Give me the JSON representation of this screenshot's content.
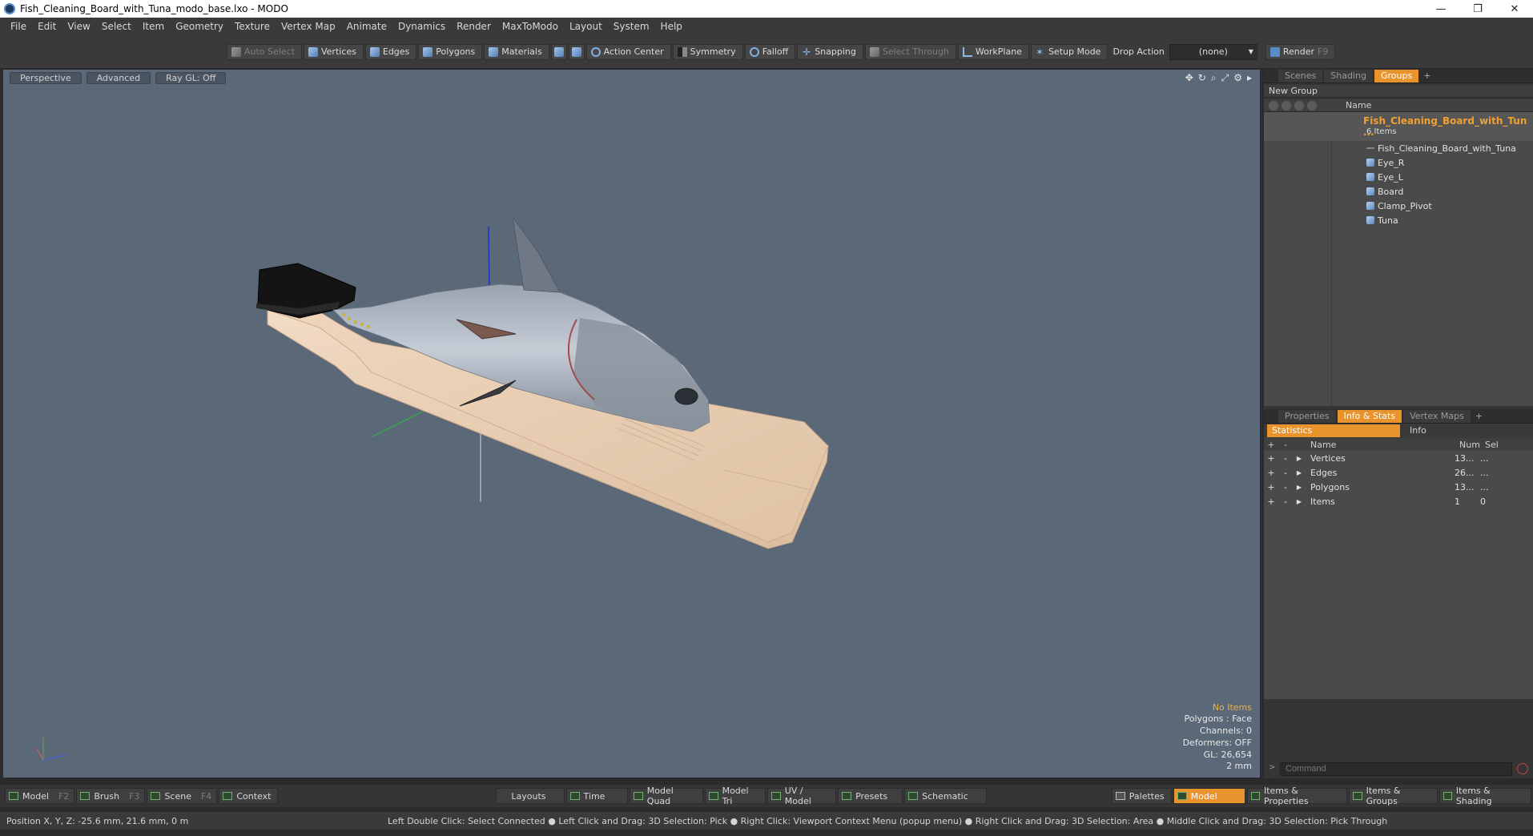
{
  "window": {
    "title": "Fish_Cleaning_Board_with_Tuna_modo_base.lxo - MODO",
    "minimize": "—",
    "restore": "❐",
    "close": "✕"
  },
  "menu": [
    "File",
    "Edit",
    "View",
    "Select",
    "Item",
    "Geometry",
    "Texture",
    "Vertex Map",
    "Animate",
    "Dynamics",
    "Render",
    "MaxToModo",
    "Layout",
    "System",
    "Help"
  ],
  "toolbar": {
    "auto_select": "Auto Select",
    "vertices": "Vertices",
    "edges": "Edges",
    "polygons": "Polygons",
    "materials": "Materials",
    "action_center": "Action Center",
    "symmetry": "Symmetry",
    "falloff": "Falloff",
    "snapping": "Snapping",
    "select_through": "Select Through",
    "workplane": "WorkPlane",
    "setup_mode": "Setup Mode",
    "drop_action_label": "Drop Action",
    "drop_action_value": "(none)",
    "render": "Render",
    "render_key": "F9"
  },
  "viewport": {
    "tabs": [
      "Perspective",
      "Advanced",
      "Ray GL: Off"
    ],
    "info": {
      "selection": "No Items",
      "polygons": "Polygons : Face",
      "channels": "Channels: 0",
      "deformers": "Deformers: OFF",
      "gl": "GL: 26,654",
      "scale": "2 mm"
    },
    "colors": {
      "background": "#5b6878",
      "board": "#e6cbb0",
      "tuna": "#b4bcc8"
    }
  },
  "groups_panel": {
    "tabs": [
      "Scenes",
      "Shading",
      "Groups"
    ],
    "active_tab": "Groups",
    "new_group": "New Group",
    "column_name": "Name",
    "root": {
      "name": "Fish_Cleaning_Board_with_Tun ...",
      "count": "6 Items"
    },
    "items": [
      "Fish_Cleaning_Board_with_Tuna",
      "Eye_R",
      "Eye_L",
      "Board",
      "Clamp_Pivot",
      "Tuna"
    ]
  },
  "stats_panel": {
    "tabs": [
      "Properties",
      "Info & Stats",
      "Vertex Maps"
    ],
    "active_tab": "Info & Stats",
    "sub_tabs": {
      "statistics": "Statistics",
      "info": "Info"
    },
    "columns": {
      "name": "Name",
      "num": "Num",
      "sel": "Sel"
    },
    "rows": [
      {
        "name": "Vertices",
        "num": "13...",
        "sel": "..."
      },
      {
        "name": "Edges",
        "num": "26...",
        "sel": "..."
      },
      {
        "name": "Polygons",
        "num": "13...",
        "sel": "..."
      },
      {
        "name": "Items",
        "num": "1",
        "sel": "0"
      }
    ],
    "command_placeholder": "Command"
  },
  "modebar": {
    "left": [
      {
        "label": "Model",
        "key": "F2"
      },
      {
        "label": "Brush",
        "key": "F3"
      },
      {
        "label": "Scene",
        "key": "F4"
      },
      {
        "label": "Context",
        "key": ""
      }
    ],
    "center": [
      "Layouts",
      "Time",
      "Model Quad",
      "Model Tri",
      "UV / Model",
      "Presets",
      "Schematic"
    ],
    "right": [
      "Palettes",
      "Model",
      "Items & Properties",
      "Items & Groups",
      "Items & Shading"
    ]
  },
  "status": {
    "position": "Position X, Y, Z:   -25.6 mm, 21.6 mm, 0 m",
    "hint": "Left Double Click: Select Connected ● Left Click and Drag: 3D Selection: Pick ● Right Click: Viewport Context Menu (popup menu) ● Right Click and Drag: 3D Selection: Area ● Middle Click and Drag: 3D Selection: Pick Through"
  }
}
